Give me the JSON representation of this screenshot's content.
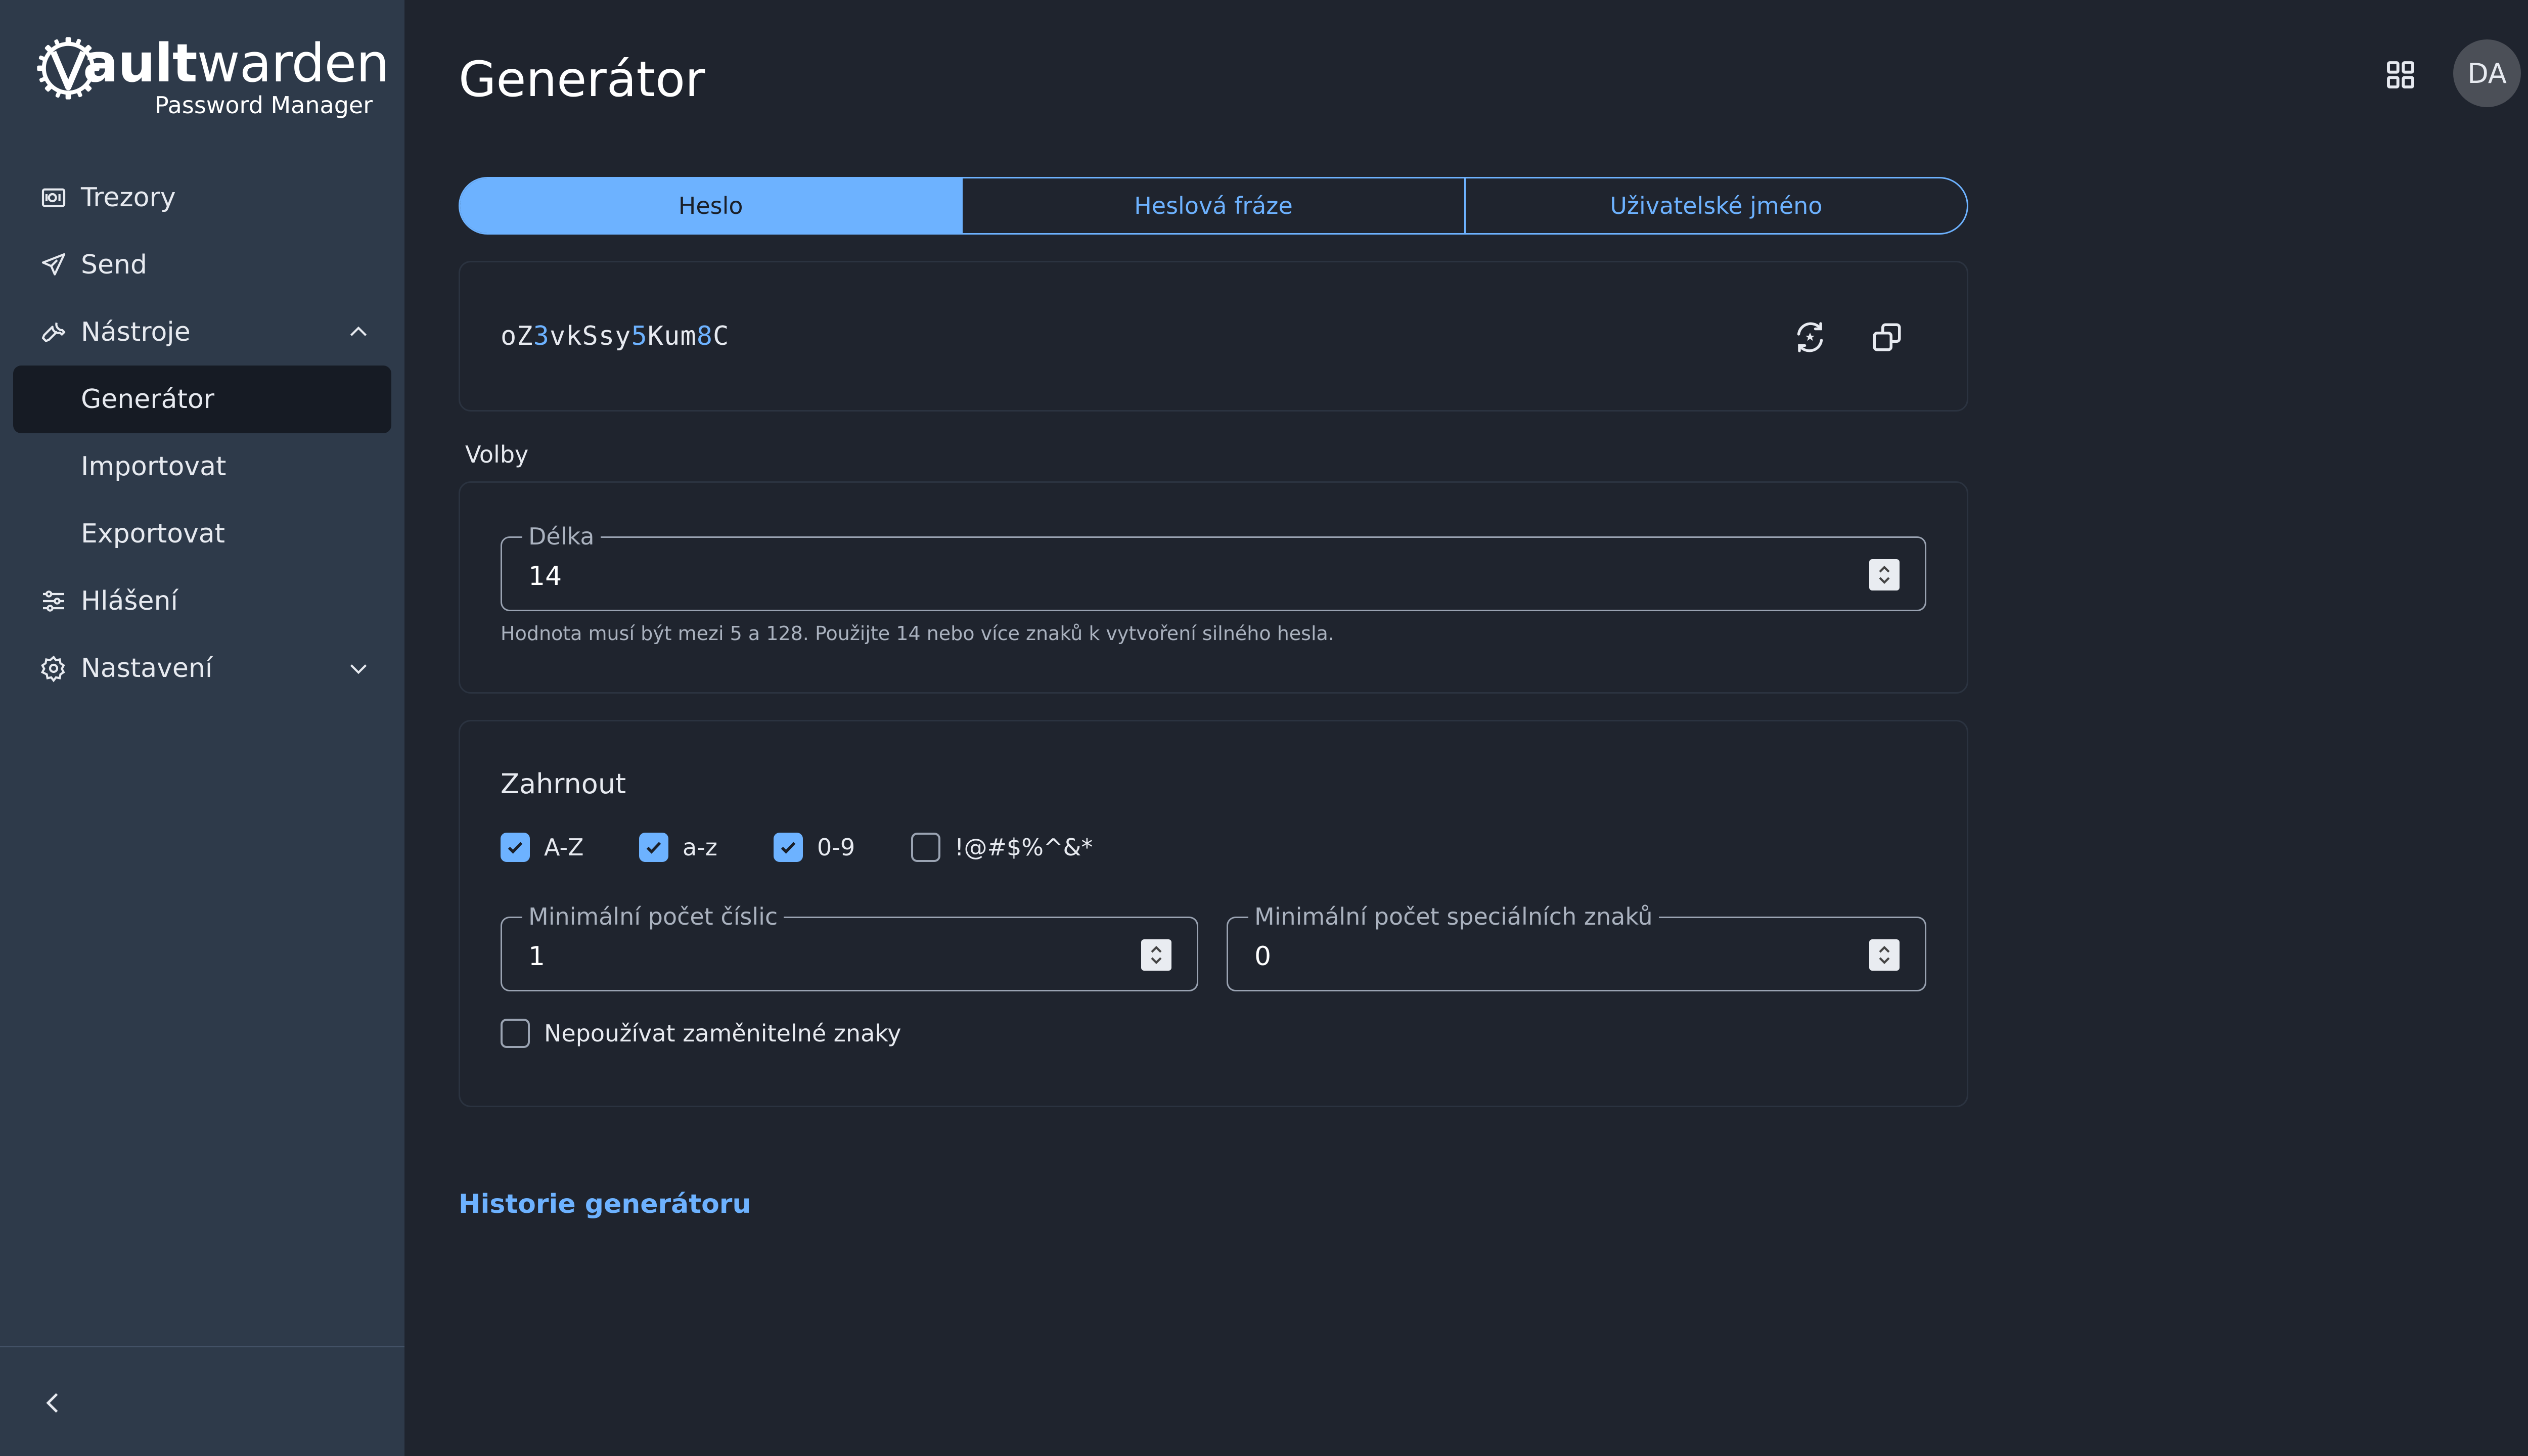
{
  "brand": {
    "name_bold": "Vault",
    "name_bold_extra": "ault",
    "name_rest": "warden",
    "tagline": "Password Manager"
  },
  "sidebar": {
    "items": [
      {
        "label": "Trezory",
        "icon": "vault-icon"
      },
      {
        "label": "Send",
        "icon": "paper-plane-icon"
      },
      {
        "label": "Nástroje",
        "icon": "wrench-icon",
        "expanded": true
      },
      {
        "label": "Generátor",
        "active": true
      },
      {
        "label": "Importovat"
      },
      {
        "label": "Exportovat"
      },
      {
        "label": "Hlášení",
        "icon": "sliders-icon"
      },
      {
        "label": "Nastavení",
        "icon": "gear-icon",
        "expanded": false
      }
    ],
    "collapse_icon": "chevron-left-icon"
  },
  "header": {
    "title": "Generátor",
    "apps_icon": "grid-icon",
    "avatar_initials": "DA"
  },
  "tabs": [
    {
      "label": "Heslo",
      "active": true
    },
    {
      "label": "Heslová fráze",
      "active": false
    },
    {
      "label": "Uživatelské jméno",
      "active": false
    }
  ],
  "generated": {
    "parts": [
      "oZ",
      "3",
      "vkSsy",
      "5",
      "Kum",
      "8",
      "C"
    ],
    "regenerate_icon": "refresh-icon",
    "copy_icon": "copy-icon"
  },
  "options": {
    "section_label": "Volby",
    "length_label": "Délka",
    "length_value": "14",
    "length_hint": "Hodnota musí být mezi 5 a 128. Použijte 14 nebo více znaků k vytvoření silného hesla."
  },
  "include": {
    "title": "Zahrnout",
    "checks": [
      {
        "label": "A-Z",
        "checked": true
      },
      {
        "label": "a-z",
        "checked": true
      },
      {
        "label": "0-9",
        "checked": true
      },
      {
        "label": "!@#$%^&*",
        "checked": false
      }
    ],
    "min_numbers_label": "Minimální počet číslic",
    "min_numbers_value": "1",
    "min_special_label": "Minimální počet speciálních znaků",
    "min_special_value": "0",
    "avoid_ambiguous_label": "Nepoužívat zaměnitelné znaky",
    "avoid_ambiguous_checked": false
  },
  "history_link": "Historie generátoru",
  "colors": {
    "accent": "#6db2ff",
    "sidebar_bg": "#2e3a4a",
    "main_bg": "#1f242e"
  }
}
